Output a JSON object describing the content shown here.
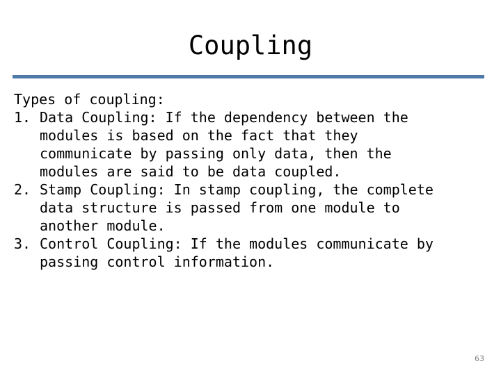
{
  "slide": {
    "title": "Coupling",
    "divider_color": "#4f7aa8",
    "background_color": "#ffffff",
    "text_color": "#000000",
    "lead_line": "Types of coupling:",
    "items": [
      {
        "marker": "1.",
        "text": "Data Coupling: If the dependency between the\nmodules is based on the fact that they\ncommunicate by passing only data, then the\nmodules are said to be data coupled."
      },
      {
        "marker": "2.",
        "text": "Stamp Coupling: In stamp coupling, the complete\ndata structure is passed from one module to\nanother module."
      },
      {
        "marker": "3.",
        "text": "Control Coupling: If the modules communicate by\npassing control information."
      }
    ],
    "page_number": "63",
    "page_number_color": "#808080"
  }
}
